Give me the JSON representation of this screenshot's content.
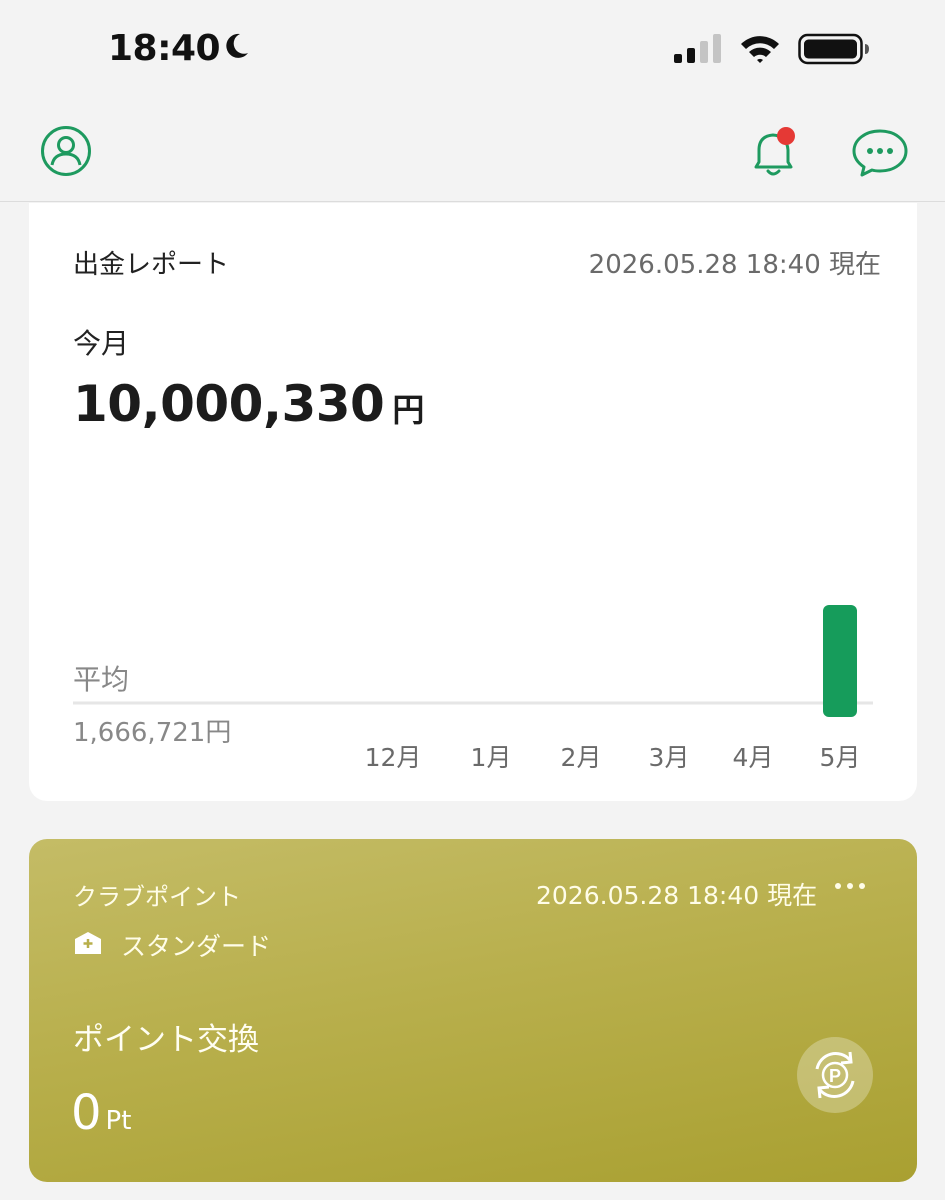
{
  "status_bar": {
    "time": "18:40"
  },
  "header": {
    "notification_badge_color": "#e53935",
    "accent_color": "#1e9a5f"
  },
  "report": {
    "title": "出金レポート",
    "timestamp": "2026.05.28 18:40 現在",
    "month_label": "今月",
    "amount": "10,000,330",
    "amount_unit": "円",
    "average_label": "平均",
    "average_value": "1,666,721円"
  },
  "chart_data": {
    "type": "bar",
    "categories": [
      "12月",
      "1月",
      "2月",
      "3月",
      "4月",
      "5月"
    ],
    "values": [
      0,
      0,
      0,
      0,
      0,
      10000330
    ],
    "bar_color": "#169c5b"
  },
  "club": {
    "title": "クラブポイント",
    "timestamp": "2026.05.28 18:40 現在",
    "rank": "スタンダード",
    "exchange_label": "ポイント交換",
    "points": "0",
    "points_unit": "Pt"
  }
}
